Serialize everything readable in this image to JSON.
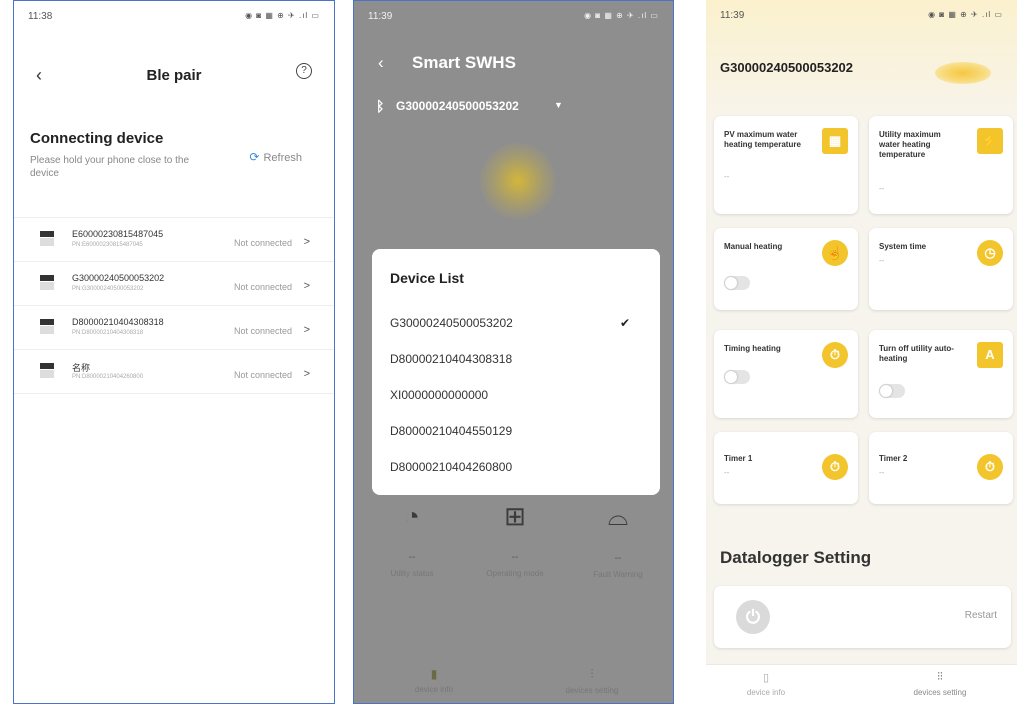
{
  "status": {
    "time1": "11:38",
    "time2": "11:39",
    "time3": "11:39",
    "icons": "◉ ◙ ▦ ⊕ ✈ .ıl ▭"
  },
  "ble": {
    "title": "Ble pair",
    "heading": "Connecting device",
    "subtitle": "Please hold your phone close to the device",
    "refresh": "Refresh",
    "devices": [
      {
        "name": "E60000230815487045",
        "pn": "PN:E60000230815487045",
        "status": "Not connected"
      },
      {
        "name": "G30000240500053202",
        "pn": "PN:G30000240500053202",
        "status": "Not connected"
      },
      {
        "name": "D80000210404308318",
        "pn": "PN:D80000210404308318",
        "status": "Not connected"
      },
      {
        "name": "名称",
        "pn": "PN:D80000210404260800",
        "status": "Not connected"
      }
    ]
  },
  "smart": {
    "title": "Smart SWHS",
    "device_sn": "G30000240500053202",
    "modal_title": "Device List",
    "devices": [
      {
        "sn": "G30000240500053202",
        "check": "✔"
      },
      {
        "sn": "D80000210404308318",
        "check": ""
      },
      {
        "sn": "XI0000000000000",
        "check": ""
      },
      {
        "sn": "D80000210404550129",
        "check": ""
      },
      {
        "sn": "D80000210404260800",
        "check": ""
      }
    ],
    "bottom_items": [
      {
        "value": "--",
        "label": "Utility status"
      },
      {
        "value": "--",
        "label": "Operating mode"
      },
      {
        "value": "--",
        "label": "Fault Warning"
      }
    ],
    "nav": {
      "info": "device info",
      "setting": "devices setting"
    }
  },
  "settings": {
    "device_sn": "G30000240500053202",
    "cards": {
      "pv_max": {
        "label": "PV maximum water heating temperature",
        "value": "--"
      },
      "utility_max": {
        "label": "Utility maximum water heating temperature",
        "value": "--"
      },
      "manual": {
        "label": "Manual heating"
      },
      "system_time": {
        "label": "System time",
        "value": "--"
      },
      "timing": {
        "label": "Timing heating"
      },
      "turn_off": {
        "label": "Turn off utility auto-heating"
      },
      "timer1": {
        "label": "Timer 1",
        "value": "--"
      },
      "timer2": {
        "label": "Timer 2",
        "value": "--"
      }
    },
    "datalogger_title": "Datalogger Setting",
    "restart": "Restart",
    "nav": {
      "info": "device info",
      "setting": "devices setting"
    }
  },
  "colors": {
    "accent_blue": "#3a8be6",
    "yellow": "#f3c52d",
    "border_blue": "#4b74c6"
  }
}
